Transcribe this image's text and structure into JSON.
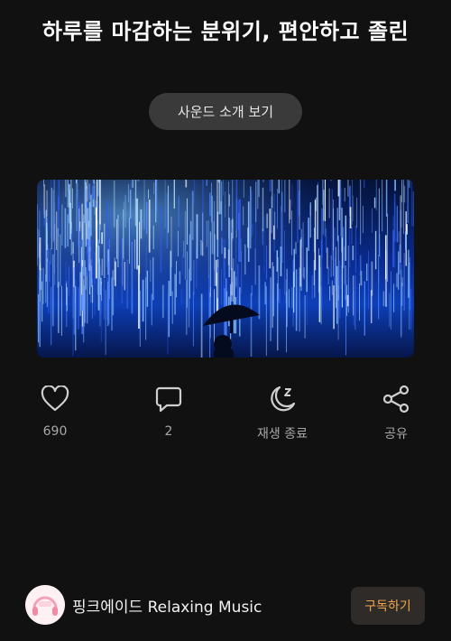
{
  "header": {
    "title": "하루를 마감하는 분위기, 편안하고 졸린"
  },
  "intro_button": {
    "label": "사운드 소개 보기"
  },
  "actions": {
    "like": {
      "icon": "heart-icon",
      "label": "690"
    },
    "comment": {
      "icon": "comment-icon",
      "label": "2"
    },
    "sleep_timer": {
      "icon": "moon-sleep-icon",
      "label": "재생 종료"
    },
    "share": {
      "icon": "share-icon",
      "label": "공유"
    }
  },
  "channel": {
    "name": "핑크에이드 Relaxing Music",
    "subscribe_label": "구독하기",
    "avatar_icon": "pink-headphones-logo"
  },
  "colors": {
    "background": "#111111",
    "accent": "#f0a64a",
    "button_bg": "#3a3a3a"
  }
}
